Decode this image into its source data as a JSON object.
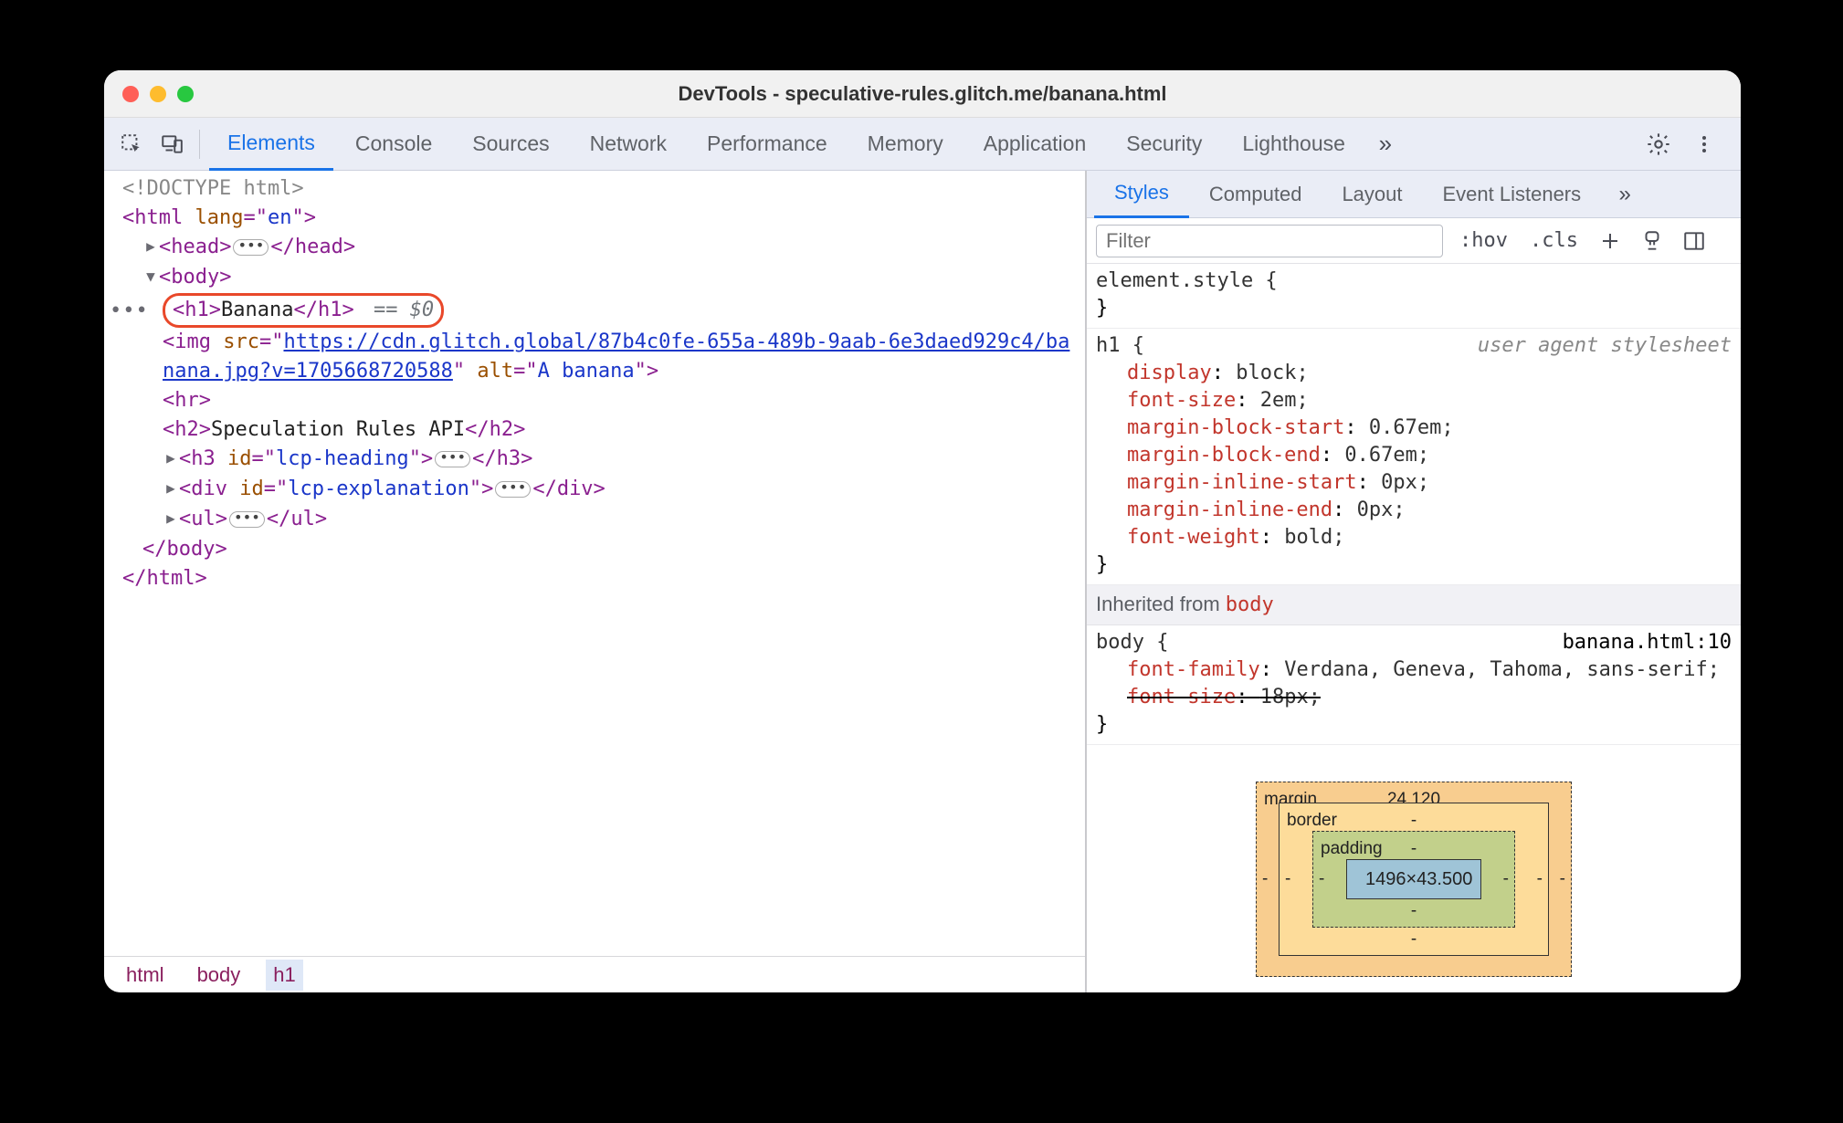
{
  "window": {
    "title": "DevTools - speculative-rules.glitch.me/banana.html"
  },
  "tabs": {
    "items": [
      "Elements",
      "Console",
      "Sources",
      "Network",
      "Performance",
      "Memory",
      "Application",
      "Security",
      "Lighthouse"
    ],
    "active": 0
  },
  "dom": {
    "doctype": "<!DOCTYPE html>",
    "html_open": "<html lang=\"en\">",
    "head": {
      "open": "<head>",
      "close": "</head>"
    },
    "body_open": "<body>",
    "h1": {
      "open": "<h1>",
      "text": "Banana",
      "close": "</h1>",
      "selected_suffix": "== $0"
    },
    "img_src_url": "https://cdn.glitch.global/87b4c0fe-655a-489b-9aab-6e3daed929c4/banana.jpg?v=1705668720588",
    "img_line1_pre": "<img src=\"",
    "img_line1_link": "https://cdn.glitch.global/87b4c0fe-655a-489b-9aab-6e3daed929c4/ba",
    "img_line2_link": "nana.jpg?v=1705668720588",
    "img_line2_post": "\" alt=\"A banana\">",
    "hr": "<hr>",
    "h2": {
      "open": "<h2>",
      "text": "Speculation Rules API",
      "close": "</h2>"
    },
    "h3": {
      "open": "<h3 id=\"lcp-heading\">",
      "close": "</h3>"
    },
    "div": {
      "open": "<div id=\"lcp-explanation\">",
      "close": "</div>"
    },
    "ul": {
      "open": "<ul>",
      "close": "</ul>"
    },
    "body_close": "</body>",
    "html_close": "</html>"
  },
  "breadcrumb": [
    "html",
    "body",
    "h1"
  ],
  "styles_tabs": {
    "items": [
      "Styles",
      "Computed",
      "Layout",
      "Event Listeners"
    ],
    "active": 0
  },
  "styles_toolbar": {
    "filter_placeholder": "Filter",
    "hov": ":hov",
    "cls": ".cls"
  },
  "styles": {
    "element_style": {
      "selector": "element.style",
      "decls": []
    },
    "h1_rule": {
      "selector": "h1",
      "source": "user agent stylesheet",
      "decls": [
        {
          "prop": "display",
          "val": "block"
        },
        {
          "prop": "font-size",
          "val": "2em"
        },
        {
          "prop": "margin-block-start",
          "val": "0.67em"
        },
        {
          "prop": "margin-block-end",
          "val": "0.67em"
        },
        {
          "prop": "margin-inline-start",
          "val": "0px"
        },
        {
          "prop": "margin-inline-end",
          "val": "0px"
        },
        {
          "prop": "font-weight",
          "val": "bold"
        }
      ]
    },
    "inherited_label": "Inherited from",
    "inherited_from": "body",
    "body_rule": {
      "selector": "body",
      "source": "banana.html:10",
      "decls": [
        {
          "prop": "font-family",
          "val": "Verdana, Geneva, Tahoma, sans-serif"
        },
        {
          "prop": "font-size",
          "val": "18px",
          "strike": true
        }
      ]
    }
  },
  "box_model": {
    "margin": {
      "label": "margin",
      "top": "24.120",
      "right": "-",
      "bottom": "-",
      "left": "-"
    },
    "border": {
      "label": "border",
      "top": "-",
      "right": "-",
      "bottom": "-",
      "left": "-"
    },
    "padding": {
      "label": "padding",
      "top": "-",
      "right": "-",
      "bottom": "-",
      "left": "-"
    },
    "content": "1496×43.500"
  }
}
